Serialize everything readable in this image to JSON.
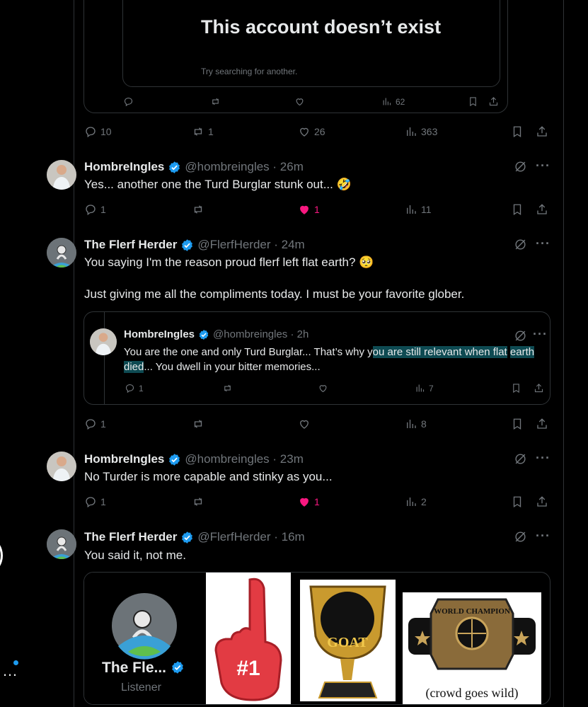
{
  "top_card": {
    "notice_title": "This account doesn’t exist",
    "notice_sub": "Try searching for another.",
    "views": "62"
  },
  "top_post_actions": {
    "replies": "10",
    "reposts": "1",
    "likes": "26",
    "views": "363"
  },
  "posts": [
    {
      "name": "HombreIngles",
      "handle": "@hombreingles · 26m",
      "text": "Yes... another one the Turd Burglar stunk out...",
      "emoji": "🤣",
      "replies": "1",
      "reposts": "",
      "likes": "1",
      "liked": true,
      "views": "11"
    },
    {
      "name": "The Flerf Herder",
      "handle": "@FlerfHerder · 24m",
      "text_1": "You saying I'm the reason proud flerf left flat earth?",
      "emoji": "🥺",
      "text_2": "Just giving me all the compliments today. I must be your favorite glober.",
      "replies": "1",
      "reposts": "",
      "likes": "",
      "liked": false,
      "views": "8",
      "quote": {
        "name": "HombreIngles",
        "handle": "@hombreingles · 2h",
        "text_before": "You are the one and only Turd Burglar... That’s why y",
        "text_highlight_1": "ou are still relevant when flat",
        "text_highlight_2": "earth died",
        "text_after": "... You dwell in your bitter memories...",
        "replies": "1",
        "views": "7"
      }
    },
    {
      "name": "HombreIngles",
      "handle": "@hombreingles · 23m",
      "text": "No Turder is more capable and stinky as you...",
      "replies": "1",
      "reposts": "",
      "likes": "1",
      "liked": true,
      "views": "2"
    },
    {
      "name": "The Flerf Herder",
      "handle": "@FlerfHerder · 16m",
      "text": "You said it, not me.",
      "media": {
        "profile_name": "The Fle...",
        "profile_role": "Listener",
        "foam_finger_text": "#1",
        "goat_text": "GOAT",
        "belt_text": "WORLD CHAMPION",
        "belt_caption": "(crowd goes wild)"
      }
    }
  ],
  "colors": {
    "accent": "#1d9bf0",
    "like": "#f91880",
    "muted": "#71767b",
    "highlight": "#0e4a52"
  }
}
